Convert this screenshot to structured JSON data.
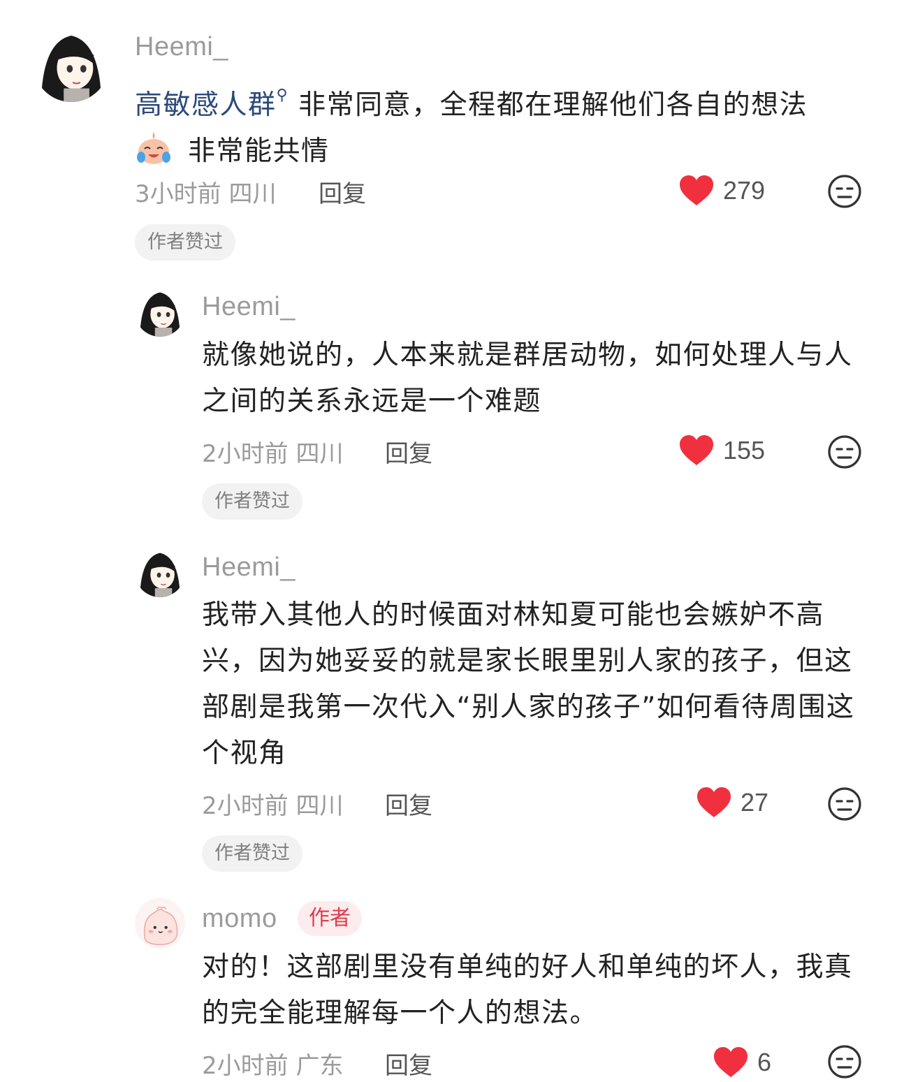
{
  "comments": [
    {
      "username": "Heemi_",
      "topic": "高敏感人群",
      "text_line1_rest": "非常同意，全程都在理解他们各自的想法",
      "text_line2": "非常能共情",
      "time": "3小时前",
      "location": "四川",
      "reply_label": "回复",
      "likes": "279",
      "liked_badge": "作者赞过"
    },
    {
      "username": "Heemi_",
      "text": "就像她说的，人本来就是群居动物，如何处理人与人之间的关系永远是一个难题",
      "time": "2小时前",
      "location": "四川",
      "reply_label": "回复",
      "likes": "155",
      "liked_badge": "作者赞过"
    },
    {
      "username": "Heemi_",
      "text": "我带入其他人的时候面对林知夏可能也会嫉妒不高兴，因为她妥妥的就是家长眼里别人家的孩子，但这部剧是我第一次代入“别人家的孩子”如何看待周围这个视角",
      "time": "2小时前",
      "location": "四川",
      "reply_label": "回复",
      "likes": "27",
      "liked_badge": "作者赞过"
    },
    {
      "username": "momo",
      "author_badge": "作者",
      "text": "对的！这部剧里没有单纯的好人和单纯的坏人，我真的完全能理解每一个人的想法。",
      "time": "2小时前",
      "location": "广东",
      "reply_label": "回复",
      "likes": "6"
    }
  ],
  "icons": {
    "like": "heart-icon",
    "dislike": "dislike-face-icon",
    "topic": "search-icon",
    "emoji": "crying-laughing-emoji"
  },
  "colors": {
    "like_red": "#f0303e",
    "topic_blue": "#2c4a78",
    "author_badge_bg": "#fdecee",
    "author_badge_text": "#e23b4b"
  }
}
